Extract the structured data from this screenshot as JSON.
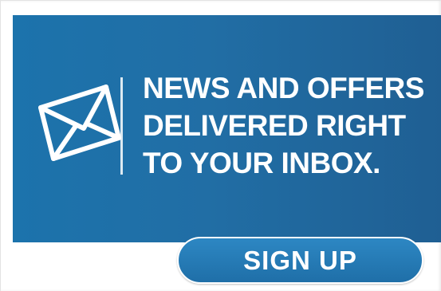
{
  "banner": {
    "icon": "envelope-icon",
    "background_color": "#1f6ea6",
    "text_color": "#ffffff",
    "headline_lines": [
      "NEWS AND OFFERS",
      "DELIVERED RIGHT",
      "TO YOUR INBOX."
    ]
  },
  "signup": {
    "label": "SIGN UP",
    "color": "#2578b5"
  }
}
